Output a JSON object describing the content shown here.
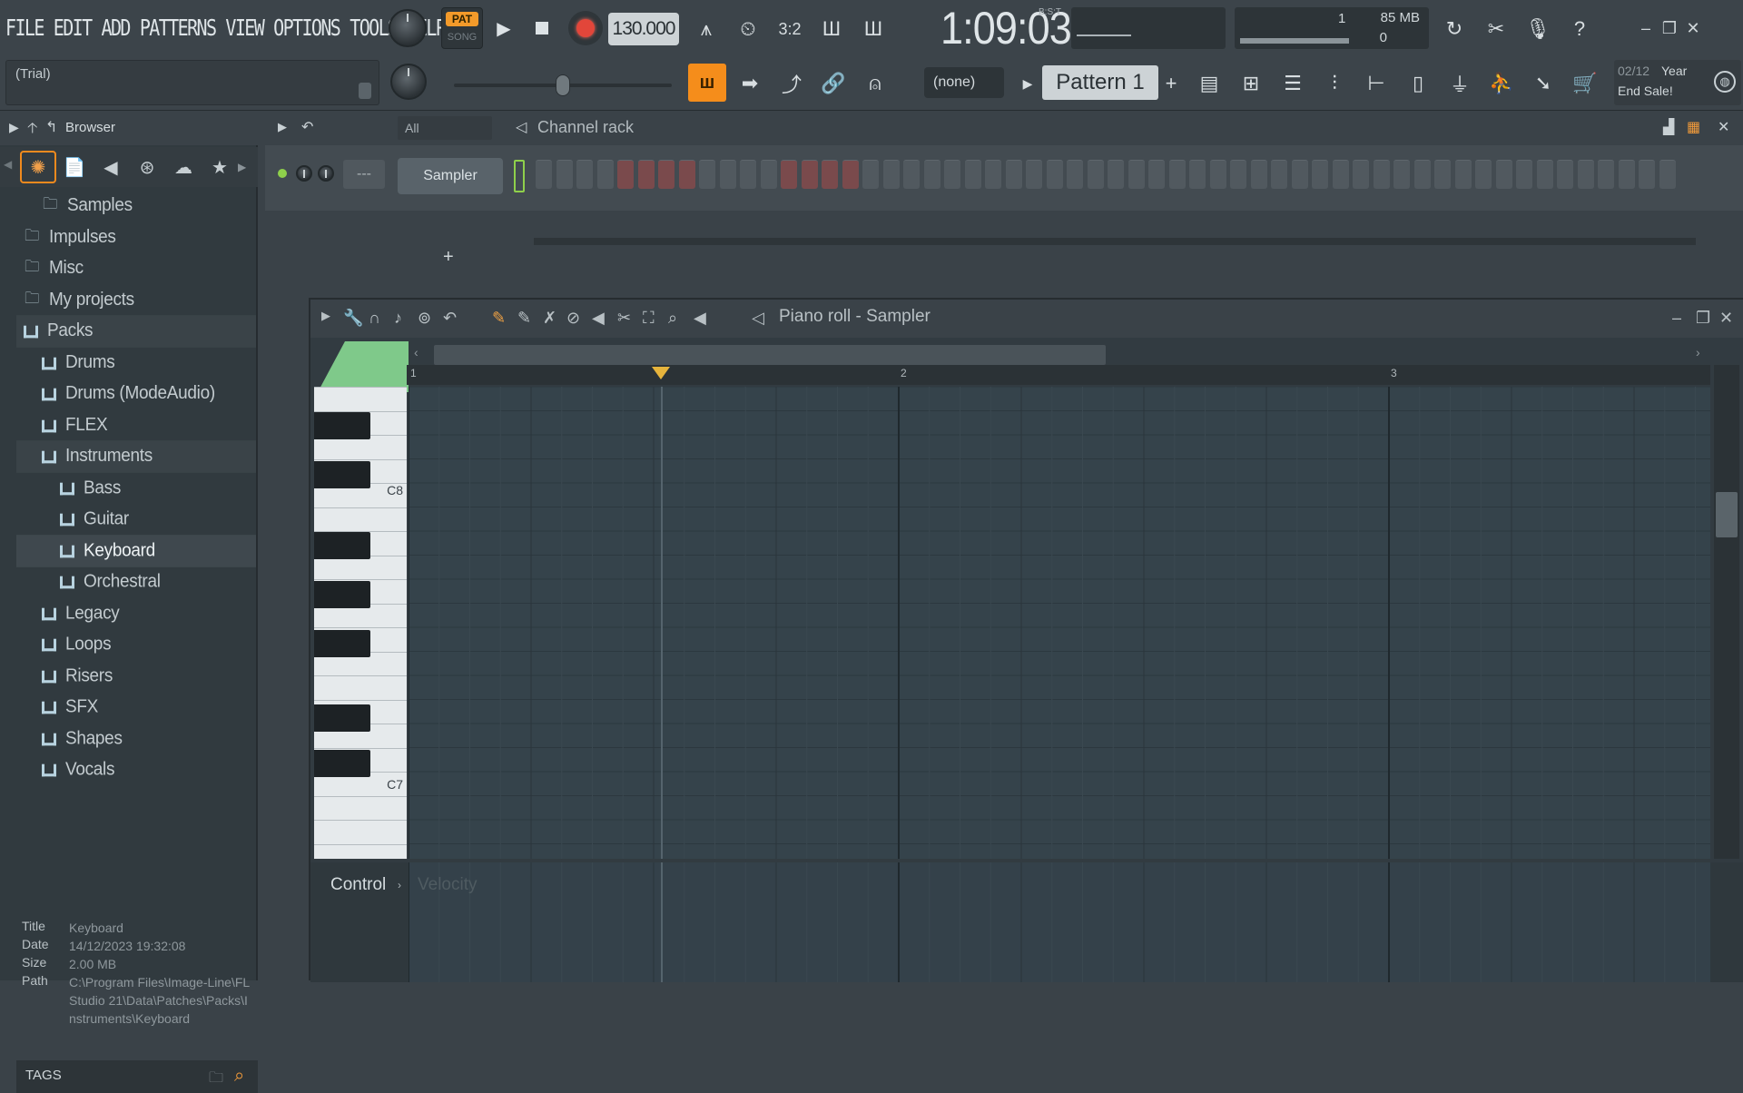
{
  "menu": [
    "FILE",
    "EDIT",
    "ADD",
    "PATTERNS",
    "VIEW",
    "OPTIONS",
    "TOOLS",
    "HELP"
  ],
  "hint": {
    "text": "(Trial)"
  },
  "transport": {
    "pat_label": "PAT",
    "song_label": "SONG",
    "tempo": "130.000"
  },
  "time": {
    "display": "1:09:03",
    "suffix": "B:S:T"
  },
  "cpu": {
    "memory": "85 MB",
    "value": "1",
    "polyphony": "0"
  },
  "snap": "(none)",
  "pattern": "Pattern 1",
  "news": {
    "date": "02/12",
    "year": "Year",
    "sale": "End Sale!"
  },
  "browser": {
    "title": "Browser",
    "tree": [
      {
        "label": "Samples",
        "type": "folder",
        "indent": 1
      },
      {
        "label": "Impulses",
        "type": "folder",
        "indent": 0
      },
      {
        "label": "Misc",
        "type": "folder",
        "indent": 0
      },
      {
        "label": "My projects",
        "type": "folder",
        "indent": 0
      },
      {
        "label": "Packs",
        "type": "pack",
        "indent": 0,
        "open": true
      },
      {
        "label": "Drums",
        "type": "pack",
        "indent": 1
      },
      {
        "label": "Drums (ModeAudio)",
        "type": "pack",
        "indent": 1
      },
      {
        "label": "FLEX",
        "type": "pack",
        "indent": 1
      },
      {
        "label": "Instruments",
        "type": "pack",
        "indent": 1,
        "open": true
      },
      {
        "label": "Bass",
        "type": "pack",
        "indent": 2
      },
      {
        "label": "Guitar",
        "type": "pack",
        "indent": 2
      },
      {
        "label": "Keyboard",
        "type": "pack",
        "indent": 2,
        "selected": true
      },
      {
        "label": "Orchestral",
        "type": "pack",
        "indent": 2
      },
      {
        "label": "Legacy",
        "type": "pack",
        "indent": 1
      },
      {
        "label": "Loops",
        "type": "pack",
        "indent": 1
      },
      {
        "label": "Risers",
        "type": "pack",
        "indent": 1
      },
      {
        "label": "SFX",
        "type": "pack",
        "indent": 1
      },
      {
        "label": "Shapes",
        "type": "pack",
        "indent": 1
      },
      {
        "label": "Vocals",
        "type": "pack",
        "indent": 1
      }
    ],
    "info": {
      "title_key": "Title",
      "title": "Keyboard",
      "date_key": "Date",
      "date": "14/12/2023 19:32:08",
      "size_key": "Size",
      "size": "2.00 MB",
      "path_key": "Path",
      "path": "C:\\Program Files\\Image-Line\\FL Studio 21\\Data\\Patches\\Packs\\Instruments\\Keyboard"
    },
    "tags_label": "TAGS"
  },
  "channel_rack": {
    "filter": "All",
    "title": "Channel rack",
    "channel": "Sampler",
    "add": "+"
  },
  "piano_roll": {
    "title": "Piano roll - Sampler",
    "bars": [
      "1",
      "2",
      "3"
    ],
    "keys": [
      "C8",
      "C7"
    ],
    "control_label": "Control",
    "control_target": "Velocity"
  },
  "colors": {
    "accent": "#f58d1b",
    "rec": "#e2463a",
    "channel_led": "#8fd04b",
    "stamp": "#7fc98a"
  }
}
